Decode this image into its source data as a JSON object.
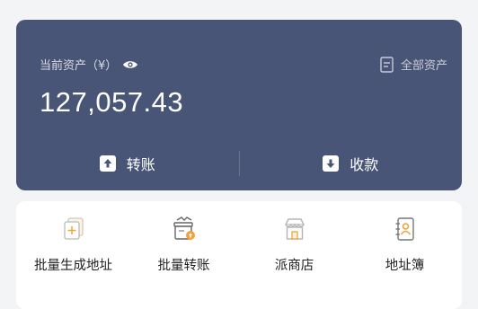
{
  "asset_card": {
    "label": "当前资产（¥）",
    "all_assets": "全部资产",
    "balance": "127,057.43",
    "actions": [
      {
        "label": "转账",
        "icon": "upload-arrow-icon"
      },
      {
        "label": "收款",
        "icon": "download-arrow-icon"
      }
    ],
    "background": "#485576"
  },
  "tools": [
    {
      "label": "批量生成地址",
      "icon": "batch-address-icon"
    },
    {
      "label": "批量转账",
      "icon": "batch-transfer-icon"
    },
    {
      "label": "派商店",
      "icon": "store-icon"
    },
    {
      "label": "地址簿",
      "icon": "address-book-icon"
    }
  ],
  "colors": {
    "accent": "#f2a23a",
    "card": "#485576"
  }
}
